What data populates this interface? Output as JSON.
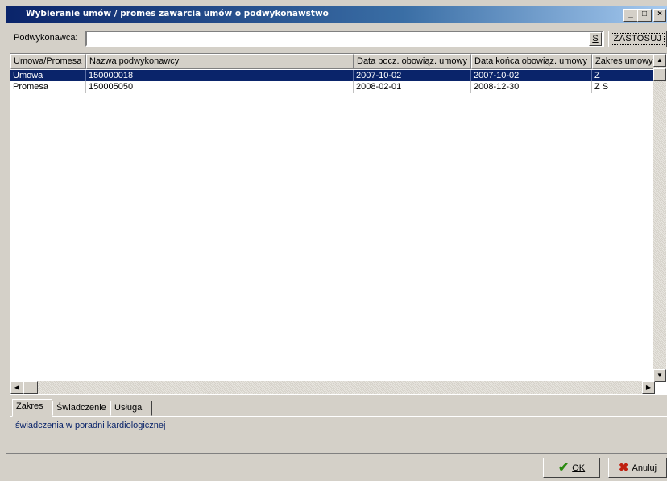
{
  "window": {
    "title": "Wybieranie umów / promes zawarcia umów o podwykonawstwo",
    "min": "_",
    "max": "□",
    "close": "×"
  },
  "search": {
    "label": "Podwykonawca:",
    "value": "",
    "s_button": "S",
    "apply_button": "ZASTOSUJ"
  },
  "grid": {
    "columns": [
      "Umowa/Promesa",
      "Nazwa podwykonawcy",
      "Data pocz. obowiąz. umowy",
      "Data końca obowiąz. umowy",
      "Zakres umowy"
    ],
    "rows": [
      [
        "Umowa",
        "150000018",
        "2007-10-02",
        "2007-10-02",
        "Z"
      ],
      [
        "Promesa",
        "150005050",
        "2008-02-01",
        "2008-12-30",
        "Z S"
      ]
    ],
    "selected_row": 0
  },
  "tabs": [
    "Zakres",
    "Świadczenie",
    "Usługa"
  ],
  "active_tab": 0,
  "detail_text": "świadczenia w poradni kardiologicznej",
  "buttons": {
    "ok": "OK",
    "cancel": "Anuluj"
  },
  "colors": {
    "selection": "#0a246a",
    "ok_check": "#2a8a10",
    "cancel_x": "#c02010"
  }
}
